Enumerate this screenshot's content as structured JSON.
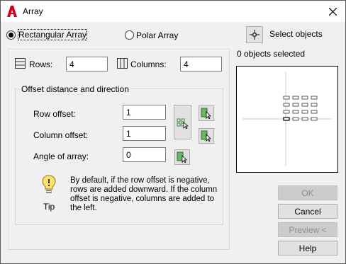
{
  "window": {
    "title": "Array"
  },
  "array_type": {
    "rectangular_label": "Rectangular Array",
    "polar_label": "Polar Array",
    "selected": "rectangular"
  },
  "select_objects": {
    "label": "Select objects",
    "status": "0 objects selected"
  },
  "grid": {
    "rows_label": "Rows:",
    "rows_value": "4",
    "columns_label": "Columns:",
    "columns_value": "4"
  },
  "offset": {
    "group_title": "Offset distance and direction",
    "row_offset_label": "Row offset:",
    "row_offset_value": "1",
    "column_offset_label": "Column offset:",
    "column_offset_value": "1",
    "angle_label": "Angle of array:",
    "angle_value": "0"
  },
  "tip": {
    "label": "Tip",
    "text": "By default, if the row offset is negative, rows are added downward.  If the column offset is negative, columns are added to the left."
  },
  "buttons": {
    "ok": "OK",
    "cancel": "Cancel",
    "preview": "Preview <",
    "help": "Help"
  },
  "colors": {
    "brand_red": "#d6001c",
    "pick_green": "#3a8a3a"
  }
}
